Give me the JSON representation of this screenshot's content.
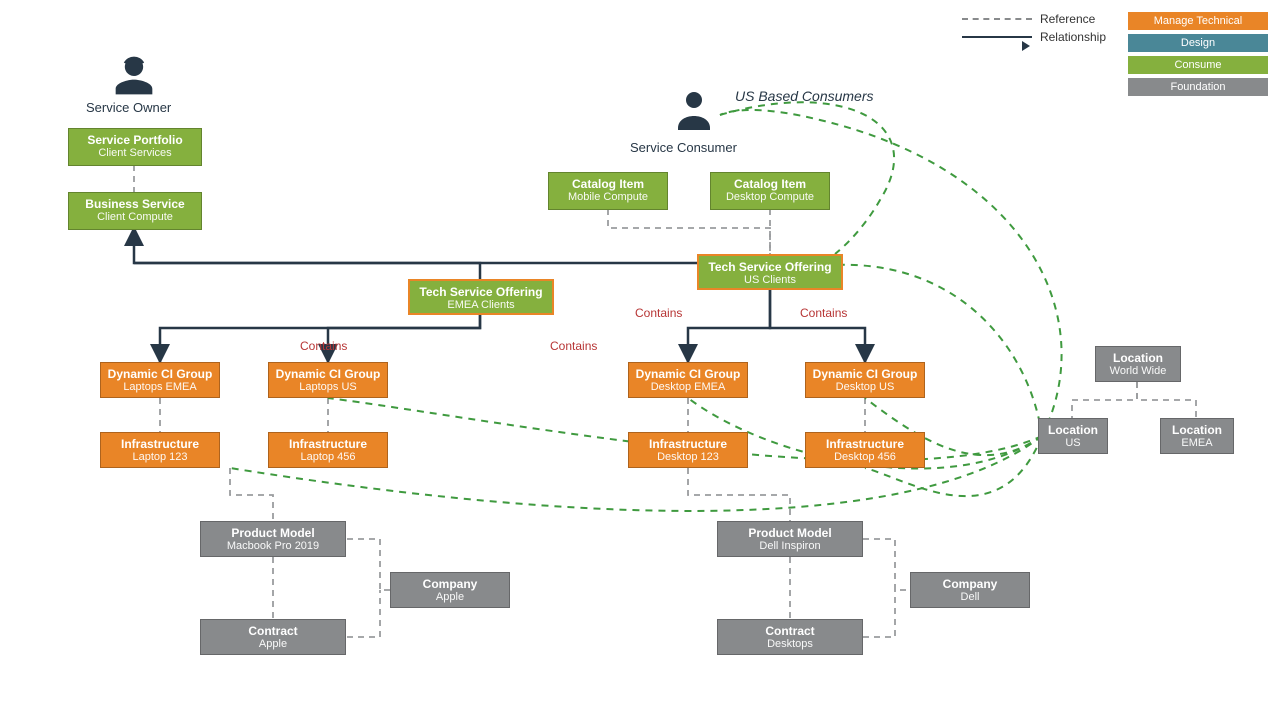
{
  "actors": {
    "owner_label": "Service Owner",
    "consumer_label": "Service Consumer"
  },
  "annotation": {
    "us_based": "US Based Consumers"
  },
  "legend": {
    "reference": "Reference",
    "relationship": "Relationship",
    "manage_technical": "Manage Technical",
    "design": "Design",
    "consume": "Consume",
    "foundation": "Foundation"
  },
  "labels": {
    "contains": "Contains"
  },
  "boxes": {
    "service_portfolio": {
      "title": "Service Portfolio",
      "sub": "Client Services"
    },
    "business_service": {
      "title": "Business Service",
      "sub": "Client Compute"
    },
    "tso_emea": {
      "title": "Tech Service Offering",
      "sub": "EMEA Clients"
    },
    "tso_us": {
      "title": "Tech Service Offering",
      "sub": "US Clients"
    },
    "catalog_mobile": {
      "title": "Catalog Item",
      "sub": "Mobile Compute"
    },
    "catalog_desktop": {
      "title": "Catalog Item",
      "sub": "Desktop Compute"
    },
    "dcg_laptops_emea": {
      "title": "Dynamic CI Group",
      "sub": "Laptops EMEA"
    },
    "dcg_laptops_us": {
      "title": "Dynamic CI Group",
      "sub": "Laptops US"
    },
    "dcg_desktop_emea": {
      "title": "Dynamic CI Group",
      "sub": "Desktop EMEA"
    },
    "dcg_desktop_us": {
      "title": "Dynamic CI Group",
      "sub": "Desktop US"
    },
    "infra_laptop123": {
      "title": "Infrastructure",
      "sub": "Laptop 123"
    },
    "infra_laptop456": {
      "title": "Infrastructure",
      "sub": "Laptop 456"
    },
    "infra_desktop123": {
      "title": "Infrastructure",
      "sub": "Desktop 123"
    },
    "infra_desktop456": {
      "title": "Infrastructure",
      "sub": "Desktop 456"
    },
    "pm_macbook": {
      "title": "Product Model",
      "sub": "Macbook Pro 2019"
    },
    "pm_dell": {
      "title": "Product Model",
      "sub": "Dell Inspiron"
    },
    "company_apple": {
      "title": "Company",
      "sub": "Apple"
    },
    "company_dell": {
      "title": "Company",
      "sub": "Dell"
    },
    "contract_apple": {
      "title": "Contract",
      "sub": "Apple"
    },
    "contract_desktops": {
      "title": "Contract",
      "sub": "Desktops"
    },
    "loc_world": {
      "title": "Location",
      "sub": "World Wide"
    },
    "loc_us": {
      "title": "Location",
      "sub": "US"
    },
    "loc_emea": {
      "title": "Location",
      "sub": "EMEA"
    }
  }
}
